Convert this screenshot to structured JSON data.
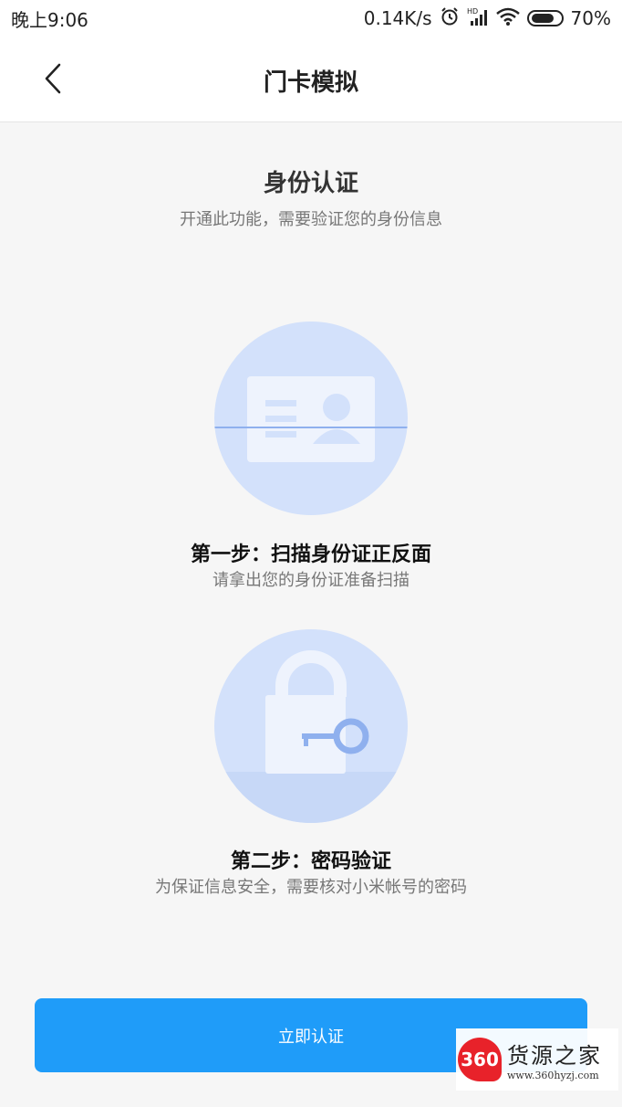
{
  "status_bar": {
    "time": "晚上9:06",
    "network_speed": "0.14K/s",
    "battery": "70%",
    "icons": [
      "alarm-icon",
      "signal-icon",
      "wifi-icon",
      "battery-icon"
    ]
  },
  "nav": {
    "title": "门卡模拟",
    "back_icon": "chevron-left-icon"
  },
  "header": {
    "title": "身份认证",
    "subtitle": "开通此功能，需要验证您的身份信息"
  },
  "steps": [
    {
      "title": "第一步：扫描身份证正反面",
      "subtitle": "请拿出您的身份证准备扫描",
      "icon": "id-card-scan-icon"
    },
    {
      "title": "第二步：密码验证",
      "subtitle": "为保证信息安全，需要核对小米帐号的密码",
      "icon": "lock-key-icon"
    }
  ],
  "actions": {
    "confirm_label": "立即认证"
  },
  "watermark": {
    "logo": "360",
    "name": "货源之家",
    "url": "www.360hyzj.com"
  },
  "colors": {
    "accent": "#1f9cf9",
    "illustration_bg": "#d3e1fb",
    "background": "#f6f6f6"
  }
}
